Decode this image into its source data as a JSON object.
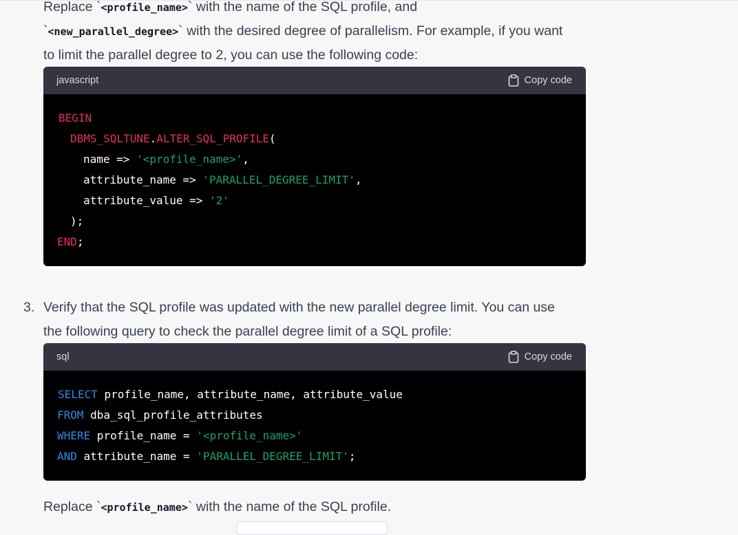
{
  "para1": {
    "line1_a": "Replace `",
    "code1": "<profile_name>",
    "line1_b": "` with the name of the SQL profile, and",
    "line2_a": "`",
    "code2": "<new_parallel_degree>",
    "line2_b": "` with the desired degree of parallelism. For example, if you want",
    "line3": "to limit the parallel degree to 2, you can use the following code:"
  },
  "codeblock1": {
    "language": "javascript",
    "copy_label": "Copy code",
    "lines": {
      "l1_kw": "BEGIN",
      "l2_pkg": "DBMS_SQLTUNE",
      "l2_dot": ".",
      "l2_fn": "ALTER_SQL_PROFILE",
      "l2_paren": "(",
      "l3_a": "name => ",
      "l3_str": "'<profile_name>'",
      "l3_c": ",",
      "l4_a": "attribute_name => ",
      "l4_str": "'PARALLEL_DEGREE_LIMIT'",
      "l4_c": ",",
      "l5_a": "attribute_value => ",
      "l5_str": "'2'",
      "l6": ");",
      "l7_kw": "END",
      "l7_c": ";"
    }
  },
  "step3": {
    "number": "3.",
    "line1": "Verify that the SQL profile was updated with the new parallel degree limit. You can use",
    "line2": "the following query to check the parallel degree limit of a SQL profile:"
  },
  "codeblock2": {
    "language": "sql",
    "copy_label": "Copy code",
    "lines": {
      "l1_kw": "SELECT",
      "l1_rest": " profile_name, attribute_name, attribute_value",
      "l2_kw": "FROM",
      "l2_rest": " dba_sql_profile_attributes",
      "l3_kw": "WHERE",
      "l3_rest": " profile_name = ",
      "l3_str": "'<profile_name>'",
      "l4_kw": "AND",
      "l4_rest": " attribute_name = ",
      "l4_str": "'PARALLEL_DEGREE_LIMIT'",
      "l4_c": ";"
    }
  },
  "para2": {
    "a": "Replace `",
    "code": "<profile_name>",
    "b": "` with the name of the SQL profile."
  },
  "icons": {
    "copy": "clipboard-icon"
  },
  "colors": {
    "keyword_red": "#e2315b",
    "keyword_blue": "#2f88e8",
    "string_green": "#19a36b",
    "code_bg": "#000000",
    "header_bg": "#343541"
  }
}
